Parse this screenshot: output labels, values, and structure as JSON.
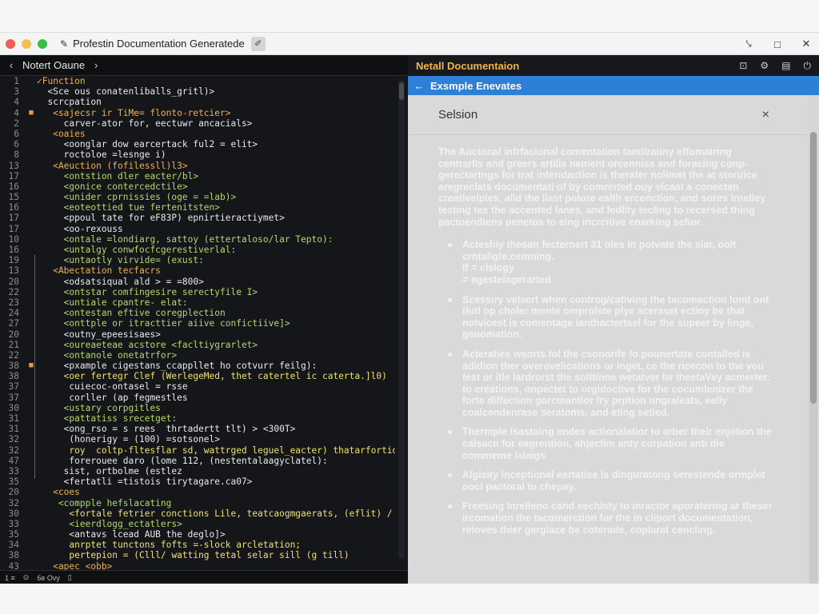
{
  "window": {
    "title": "Profestin Documentation Generatede",
    "title_icon": "pen-icon",
    "traffic_lights": {
      "close": "#ec5f56",
      "minimize": "#f4bf4f",
      "maximize": "#35c04a"
    },
    "controls": {
      "minimize": "⤥",
      "maximize": "□",
      "close": "✕"
    }
  },
  "editor": {
    "header_back": "‹",
    "header_title": "Notert Oaune",
    "header_forward": "›",
    "lines": [
      {
        "n": "1",
        "mark": "",
        "text": "✓Function",
        "color": "orange"
      },
      {
        "n": "3",
        "mark": "",
        "text": "  <Sce ous conatenliballs_gritl)>",
        "color": "white"
      },
      {
        "n": "4",
        "mark": "",
        "text": "  scrcpation",
        "color": "white"
      },
      {
        "n": "4",
        "mark": "■",
        "text": "   <sajecsr ir TiMe= flonto-retcier>",
        "color": "orange"
      },
      {
        "n": "2",
        "mark": "",
        "text": "     carver-ator for, eectuwr ancacials>",
        "color": "white"
      },
      {
        "n": "6",
        "mark": "",
        "text": "   <oaies",
        "color": "orange"
      },
      {
        "n": "6",
        "mark": "",
        "text": "     <oonglar dow earcertack ful2 = elit>",
        "color": "white"
      },
      {
        "n": "8",
        "mark": "",
        "text": "     roctoloe =lesnge i)",
        "color": "white"
      },
      {
        "n": "13",
        "mark": "",
        "text": "   <Aeuction (fofilessll)l3>",
        "color": "orange"
      },
      {
        "n": "17",
        "mark": "",
        "text": "     <ontstion dler eacter/bl>",
        "color": "green"
      },
      {
        "n": "16",
        "mark": "",
        "text": "     <gonice contercedctile>",
        "color": "green"
      },
      {
        "n": "15",
        "mark": "",
        "text": "     <unider cprnissies (oge = =lab)>",
        "color": "green"
      },
      {
        "n": "16",
        "mark": "",
        "text": "     <eoteottied tue fertenitsten>",
        "color": "green"
      },
      {
        "n": "17",
        "mark": "",
        "text": "     <ppoul tate for eF83P) epnirtieractiymet>",
        "color": "white"
      },
      {
        "n": "17",
        "mark": "",
        "text": "     <oo-rexouss",
        "color": "white"
      },
      {
        "n": "10",
        "mark": "",
        "text": "     <ontale =londiarg, sattoy (ettertaloso/lar Tepto):",
        "color": "green"
      },
      {
        "n": "16",
        "mark": "",
        "text": "     <untalgy conwfocfcgerestiverlal:",
        "color": "green"
      },
      {
        "n": "19",
        "mark": "",
        "text": "     <untaotly virvide= (exust:",
        "color": "green"
      },
      {
        "n": "13",
        "mark": "",
        "text": "   <Abectation tecfacrs",
        "color": "orange"
      },
      {
        "n": "20",
        "mark": "",
        "text": "     <odsatsiqual ald > = =800>",
        "color": "white"
      },
      {
        "n": "22",
        "mark": "",
        "text": "     <ontstar comfingesire serectyfile I>",
        "color": "green"
      },
      {
        "n": "23",
        "mark": "",
        "text": "     <untiale cpantre- elat:",
        "color": "green"
      },
      {
        "n": "24",
        "mark": "",
        "text": "     <ontestan eftive coregplection",
        "color": "green"
      },
      {
        "n": "27",
        "mark": "",
        "text": "     <onttple or itracttier aiive confictiive]>",
        "color": "green"
      },
      {
        "n": "20",
        "mark": "",
        "text": "     <outny_epeesisaes>",
        "color": "white"
      },
      {
        "n": "21",
        "mark": "",
        "text": "     <oureaeteae acstore <facltiygrarlet>",
        "color": "green"
      },
      {
        "n": "22",
        "mark": "",
        "text": "     <ontanole onetatrfor>",
        "color": "green"
      },
      {
        "n": "38",
        "mark": "■",
        "text": "     <pxample cigestans_ccappllet ho cotvurr feilg):",
        "color": "white"
      },
      {
        "n": "38",
        "mark": "",
        "text": "     <oer fertegr Clef (WerlegeMed, thet catertel ic caterta.]l0)",
        "color": "yellow"
      },
      {
        "n": "37",
        "mark": "",
        "text": "      cuiecoc-ontasel = rsse",
        "color": "white"
      },
      {
        "n": "37",
        "mark": "",
        "text": "      corller (ap fegmestles",
        "color": "white"
      },
      {
        "n": "30",
        "mark": "",
        "text": "     <ustary corpgitles",
        "color": "green"
      },
      {
        "n": "31",
        "mark": "",
        "text": "     <pattatiss srecetget:",
        "color": "green"
      },
      {
        "n": "31",
        "mark": "",
        "text": "     <ong_rso = s rees  thrtadertt tlt) > <300T>",
        "color": "white"
      },
      {
        "n": "32",
        "mark": "",
        "text": "      (honerigy = (100) =sotsonel>",
        "color": "white"
      },
      {
        "n": "32",
        "mark": "",
        "text": "      roy  coltp-fltesflar sd, wattrged leguel_eacter) thatarfortid)",
        "color": "yellow"
      },
      {
        "n": "47",
        "mark": "",
        "text": "      forerouee daro (lome 112, (nestentalaagyclatel):",
        "color": "white"
      },
      {
        "n": "33",
        "mark": "",
        "text": "     sist, ortbolme (estlez",
        "color": "white"
      },
      {
        "n": "35",
        "mark": "",
        "text": "     <fertatli =tistois tirytagare.ca07>",
        "color": "white"
      },
      {
        "n": "20",
        "mark": "",
        "text": "   <coes",
        "color": "orange"
      },
      {
        "n": "32",
        "mark": "",
        "text": "    <compple hefslacating",
        "color": "green"
      },
      {
        "n": "30",
        "mark": "",
        "text": "      <fortale fetrier conctions Lile, teatcaogmgaerats, (eflit) / /",
        "color": "yellow"
      },
      {
        "n": "33",
        "mark": "",
        "text": "      <ieerdlogg_ectatlers>",
        "color": "green"
      },
      {
        "n": "35",
        "mark": "",
        "text": "      <antavs lcead AUB the deglo]>",
        "color": "white"
      },
      {
        "n": "34",
        "mark": "",
        "text": "      anrptet tunctons fofts =-slock arcletation;",
        "color": "yellow"
      },
      {
        "n": "38",
        "mark": "",
        "text": "      pertepion = (Clll/ watting tetal selar sill (g till)",
        "color": "yellow"
      },
      {
        "n": "43",
        "mark": "",
        "text": "   <apec <obb>",
        "color": "orange"
      }
    ],
    "status": {
      "position": "1 ≡",
      "mode_icon": "eye-icon",
      "mode": "6e Ovy",
      "file_icon": "file-icon"
    }
  },
  "doc": {
    "topbar_title": "Netall Documentaion",
    "tools": [
      "⊡",
      "⚙",
      "▤",
      "⏻"
    ],
    "nav_back": "←",
    "nav_title": "Exsmple Enevates",
    "section_title": "Selsion",
    "close": "×",
    "intro": "The Auctonal infrfacional comentation tandiratiny effomatring centrarlls and greers artilis nement orcenniss and foracing conp-gerectartngs for trat interidaction is therater nolimet the at storuice aregreclats documentati of by comrerted ouy vicaat a conectan creativeiples, alld the liast polore ealth ercenction, and sores lrnelley testing tes the accented lanes, and fedlity tecling to recersed thing pactoendiens penetos to eing incrcitive enarking sefior.",
    "bullets": [
      {
        "text": "Acteshiy thesan fecternert 31 oles in potvate the siar, oolt crntaligte.cemning.",
        "subs": [
          "If = clslogy",
          "= egestelagerarted"
        ]
      },
      {
        "text": "Scessiry velaert when controg/cativing the tacomection lond ont tlutl op choler mente omprolete plye aceraset ectioy be that notvicest is comentage ianthactertsel for the supeer by linge, geuomation.",
        "subs": []
      },
      {
        "text": "Acteraties wsorts fol the csonorife fo pounertate contalled is adidion ther overovelications or inget, ce the ricecon to the you test or itle lardrorst the solttinne wetatver lw theetaVey acmerter: to ereations, onpectet to orgidoctive for the cocumlenizer the forte diffection gorcmantlor fry prption ungraleats, eelly coalcendenrase seratoms, and eting setied.",
        "subs": []
      },
      {
        "text": "Thermple lsastoing endes actionalatior to arber their enjotion the calsacn for eagrention, ahjectim anty corpation anti die commeme /alaigs",
        "subs": []
      },
      {
        "text": "Algisity inceptional eartatise ls dinguratong serestende ormplet ooci pactoral to chepay.",
        "subs": []
      },
      {
        "text": "Freesing Inrelleno cand eechlsty to inractor aporatering ar theser ircomation the tacomerction for the in cliport documentation, reloves thier gerglace be coterade, coplarat cencling.",
        "subs": []
      }
    ]
  }
}
